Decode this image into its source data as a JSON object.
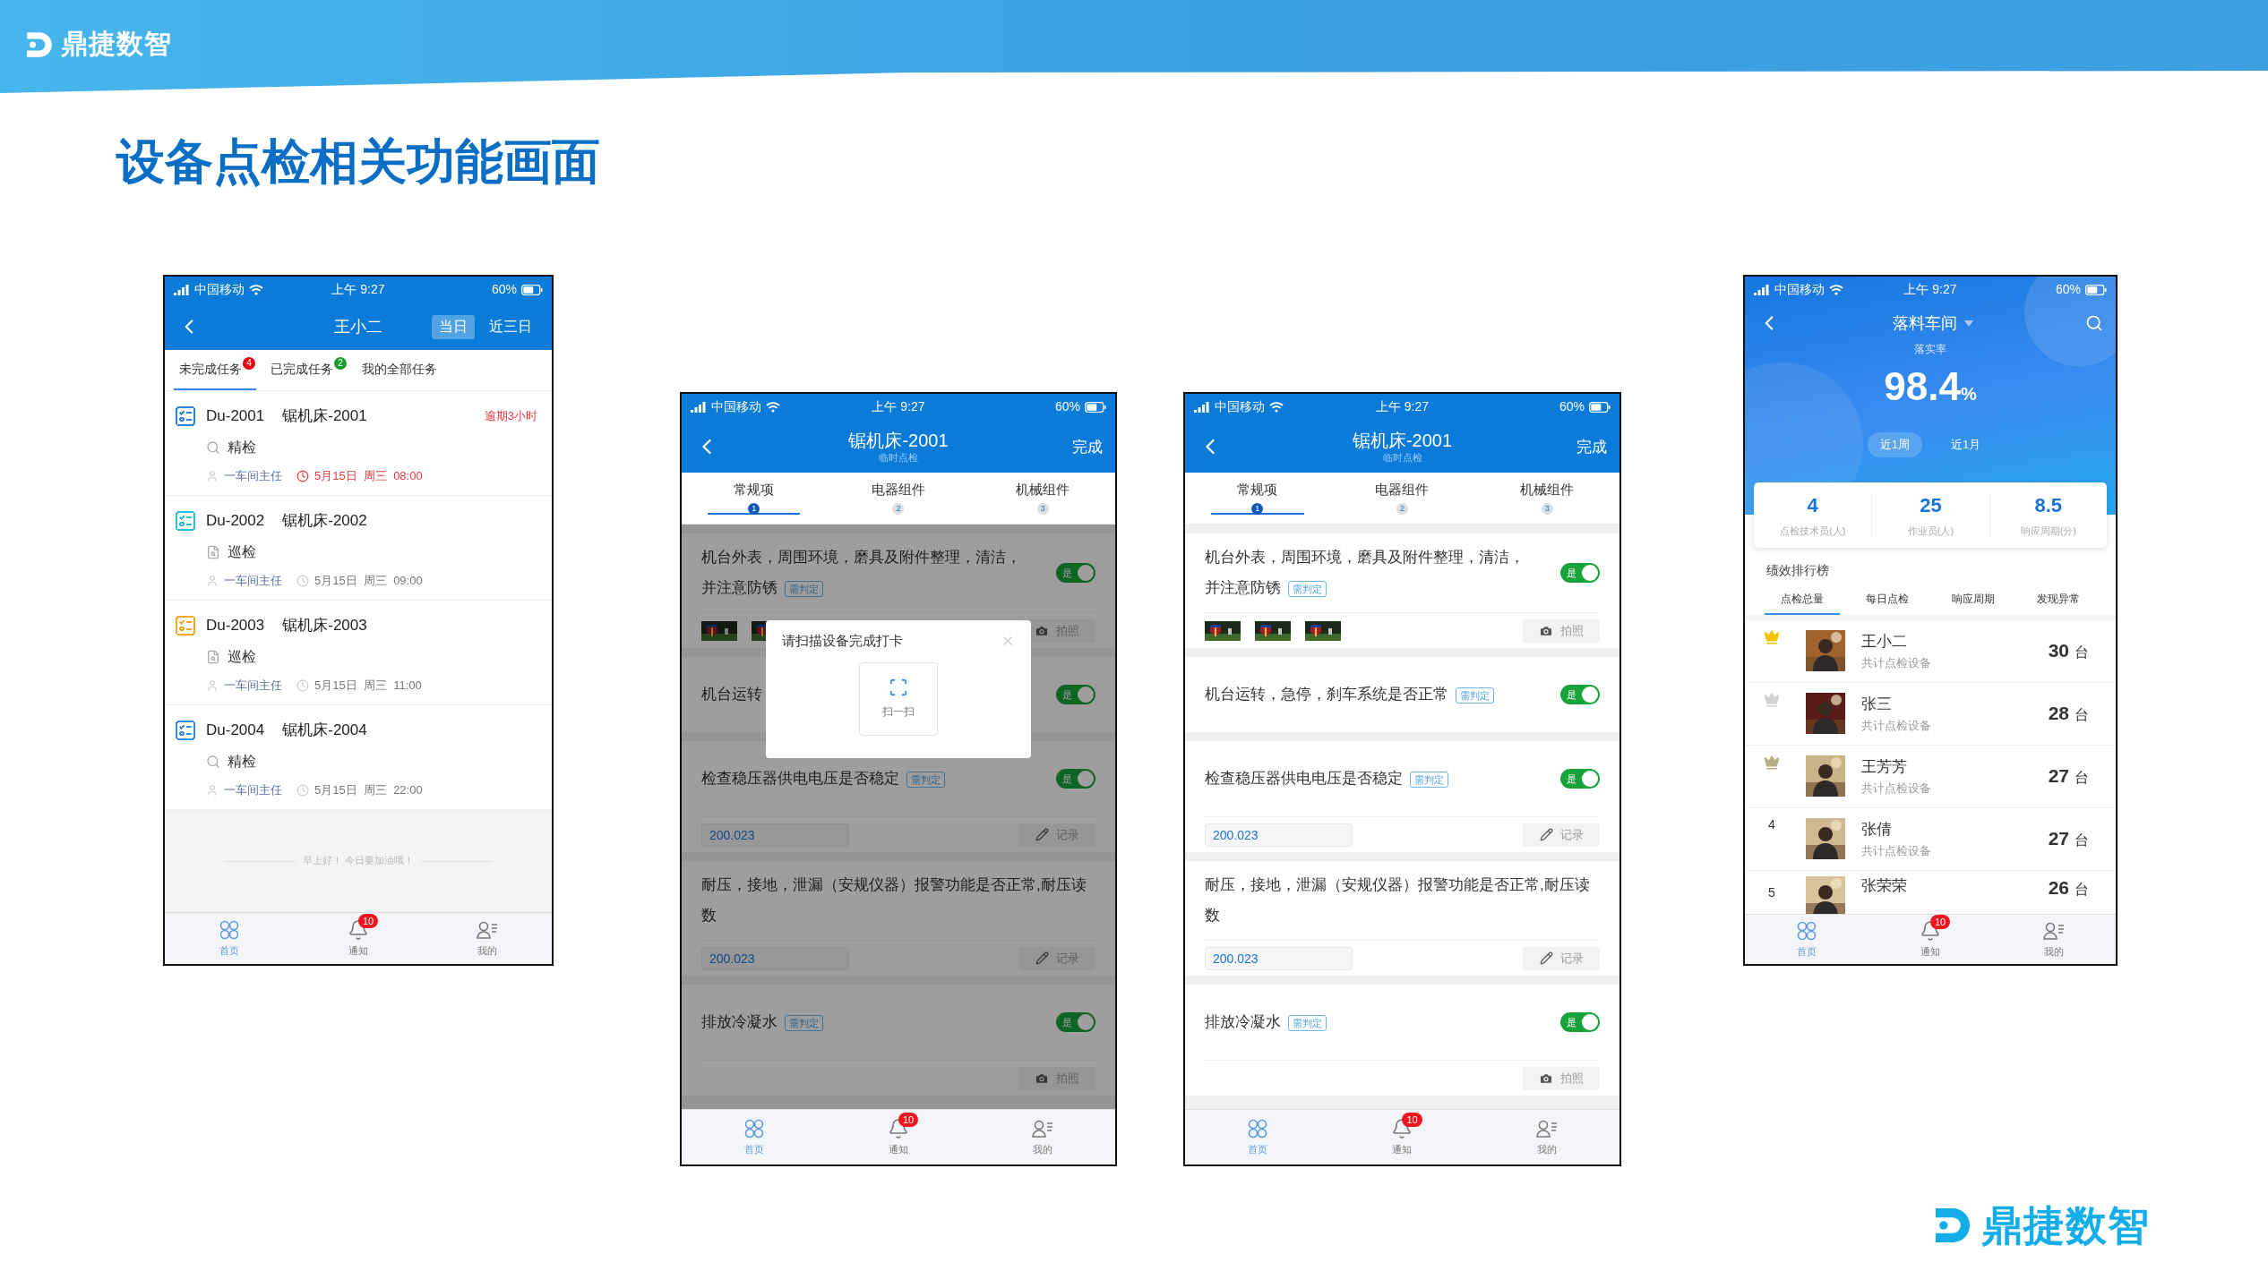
{
  "brand": "鼎捷数智",
  "title": "设备点检相关功能画面",
  "phones": [
    {
      "kind": "task_list",
      "status": {
        "carrier": "中国移动",
        "time": "上午 9:27",
        "battery": "60%"
      },
      "title": "王小二",
      "toggles": [
        {
          "label": "当日",
          "selected": true
        },
        {
          "label": "近三日",
          "selected": false
        }
      ],
      "tabs": [
        {
          "label": "未完成任务",
          "badge": "4",
          "color": "#e60012",
          "selected": true
        },
        {
          "label": "已完成任务",
          "badge": "2",
          "color": "#1a9c2c",
          "selected": false
        },
        {
          "label": "我的全部任务",
          "selected": false
        }
      ],
      "tasks": [
        {
          "code": "Du-2001",
          "machine": "锯机床-2001",
          "kind": "fine",
          "inspection": "精检",
          "color": "#2b86e0",
          "owner": "一车间主任",
          "time": "5月15日  周三  08:00",
          "overdue": true,
          "note": "逾期3小时"
        },
        {
          "code": "Du-2002",
          "machine": "锯机床-2002",
          "kind": "patrol",
          "inspection": "巡检",
          "color": "#2bc0d8",
          "owner": "一车间主任",
          "time": "5月15日  周三  09:00",
          "overdue": false
        },
        {
          "code": "Du-2003",
          "machine": "锯机床-2003",
          "kind": "patrol",
          "inspection": "巡检",
          "color": "#f5a623",
          "owner": "一车间主任",
          "time": "5月15日  周三  11:00",
          "overdue": false
        },
        {
          "code": "Du-2004",
          "machine": "锯机床-2004",
          "kind": "fine",
          "inspection": "精检",
          "color": "#3a8ee6",
          "owner": "一车间主任",
          "time": "5月15日  周三  22:00",
          "overdue": false
        }
      ],
      "greeting": "早上好！ 今日要加油哦！",
      "nav": [
        {
          "kind": "home",
          "label": "首页",
          "selected": true
        },
        {
          "kind": "bell",
          "label": "通知",
          "badge": "10",
          "selected": false
        },
        {
          "kind": "user",
          "label": "我的",
          "selected": false
        }
      ]
    },
    {
      "kind": "checklist",
      "status": {
        "carrier": "中国移动",
        "time": "上午 9:27",
        "battery": "60%"
      },
      "title": "锯机床-2001",
      "subtitle": "临时点检",
      "action": "完成",
      "steps": [
        {
          "label": "常规项",
          "number": "1",
          "selected": true
        },
        {
          "label": "电器组件",
          "number": "2",
          "selected": false
        },
        {
          "label": "机械组件",
          "number": "3",
          "selected": false
        }
      ],
      "items": [
        {
          "text": "机台外表，周围环境，磨具及附件整理，清洁，并注意防锈",
          "tag": "需判定",
          "toggle": {
            "label": "是",
            "on": true
          },
          "footer": {
            "button": "拍照"
          }
        },
        {
          "text": "机台运转",
          "toggle": {
            "label": "是",
            "on": true
          }
        },
        {
          "text": "检查稳压器供电电压是否稳定",
          "tag": "需判定",
          "toggle": {
            "label": "是",
            "on": true
          },
          "footer": {
            "kind": "record",
            "value": "200.023",
            "button": "记录"
          }
        },
        {
          "text": "耐压，接地，泄漏（安规仪器）报警功能是否正常,耐压读数",
          "footer": {
            "kind": "record",
            "value": "200.023",
            "button": "记录"
          }
        },
        {
          "text": "排放冷凝水",
          "tag": "需判定",
          "toggle": {
            "label": "是",
            "on": true
          },
          "footer": {
            "button": "拍照"
          }
        }
      ],
      "modal": {
        "title": "请扫描设备完成打卡",
        "action": "扫一扫"
      },
      "nav": [
        {
          "kind": "home",
          "label": "首页",
          "selected": true
        },
        {
          "kind": "bell",
          "label": "通知",
          "badge": "10",
          "selected": false
        },
        {
          "kind": "user",
          "label": "我的",
          "selected": false
        }
      ]
    },
    {
      "kind": "checklist",
      "status": {
        "carrier": "中国移动",
        "time": "上午 9:27",
        "battery": "60%"
      },
      "title": "锯机床-2001",
      "subtitle": "临时点检",
      "action": "完成",
      "steps": [
        {
          "label": "常规项",
          "number": "1",
          "selected": true
        },
        {
          "label": "电器组件",
          "number": "2",
          "selected": false
        },
        {
          "label": "机械组件",
          "number": "3",
          "selected": false
        }
      ],
      "items": [
        {
          "text": "机台外表，周围环境，磨具及附件整理，清洁，并注意防锈",
          "tag": "需判定",
          "toggle": {
            "label": "是",
            "on": true
          },
          "footer": {
            "button": "拍照"
          }
        },
        {
          "text": "机台运转，急停，刹车系统是否正常",
          "tag": "需判定",
          "toggle": {
            "label": "是",
            "on": true
          }
        },
        {
          "text": "检查稳压器供电电压是否稳定",
          "tag": "需判定",
          "toggle": {
            "label": "是",
            "on": true
          },
          "footer": {
            "kind": "record",
            "value": "200.023",
            "button": "记录"
          }
        },
        {
          "text": "耐压，接地，泄漏（安规仪器）报警功能是否正常,耐压读数",
          "footer": {
            "kind": "record",
            "value": "200.023",
            "button": "记录"
          }
        },
        {
          "text": "排放冷凝水",
          "tag": "需判定",
          "toggle": {
            "label": "是",
            "on": true
          },
          "footer": {
            "button": "拍照"
          }
        }
      ],
      "nav": [
        {
          "kind": "home",
          "label": "首页",
          "selected": true
        },
        {
          "kind": "bell",
          "label": "通知",
          "badge": "10",
          "selected": false
        },
        {
          "kind": "user",
          "label": "我的",
          "selected": false
        }
      ]
    },
    {
      "kind": "ranking",
      "status": {
        "carrier": "中国移动",
        "time": "上午 9:27",
        "battery": "60%"
      },
      "title": "落料车间",
      "rate_label": "落实率",
      "rate": "98.4",
      "rate_unit": "%",
      "periods": [
        {
          "label": "近1周",
          "selected": true
        },
        {
          "label": "近1月",
          "selected": false
        }
      ],
      "stats": [
        {
          "value": "4",
          "label": "点检技术员(人)"
        },
        {
          "value": "25",
          "label": "作业员(人)"
        },
        {
          "value": "8.5",
          "label": "响应周期(分)"
        }
      ],
      "section": "绩效排行榜",
      "rank_tabs": [
        {
          "label": "点检总量",
          "selected": true
        },
        {
          "label": "每日点检",
          "selected": false
        },
        {
          "label": "响应周期",
          "selected": false
        },
        {
          "label": "发现异常",
          "selected": false
        }
      ],
      "rows": [
        {
          "kind": "crown",
          "color": "#f5c400",
          "name": "王小二",
          "sub": "共计点检设备",
          "count": "30",
          "unit": "台"
        },
        {
          "kind": "crown",
          "color": "#d0d0d0",
          "name": "张三",
          "sub": "共计点检设备",
          "count": "28",
          "unit": "台"
        },
        {
          "kind": "crown",
          "color": "#b9ad86",
          "name": "王芳芳",
          "sub": "共计点检设备",
          "count": "27",
          "unit": "台"
        },
        {
          "kind": "number",
          "rank": "4",
          "name": "张倩",
          "sub": "共计点检设备",
          "count": "27",
          "unit": "台"
        },
        {
          "kind": "number",
          "rank": "5",
          "name": "张荣荣",
          "count": "26",
          "unit": "台"
        }
      ],
      "nav": [
        {
          "kind": "home",
          "label": "首页",
          "selected": true
        },
        {
          "kind": "bell",
          "label": "通知",
          "badge": "10",
          "selected": false
        },
        {
          "kind": "user",
          "label": "我的",
          "selected": false
        }
      ]
    }
  ],
  "footer_brand": "鼎捷数智"
}
